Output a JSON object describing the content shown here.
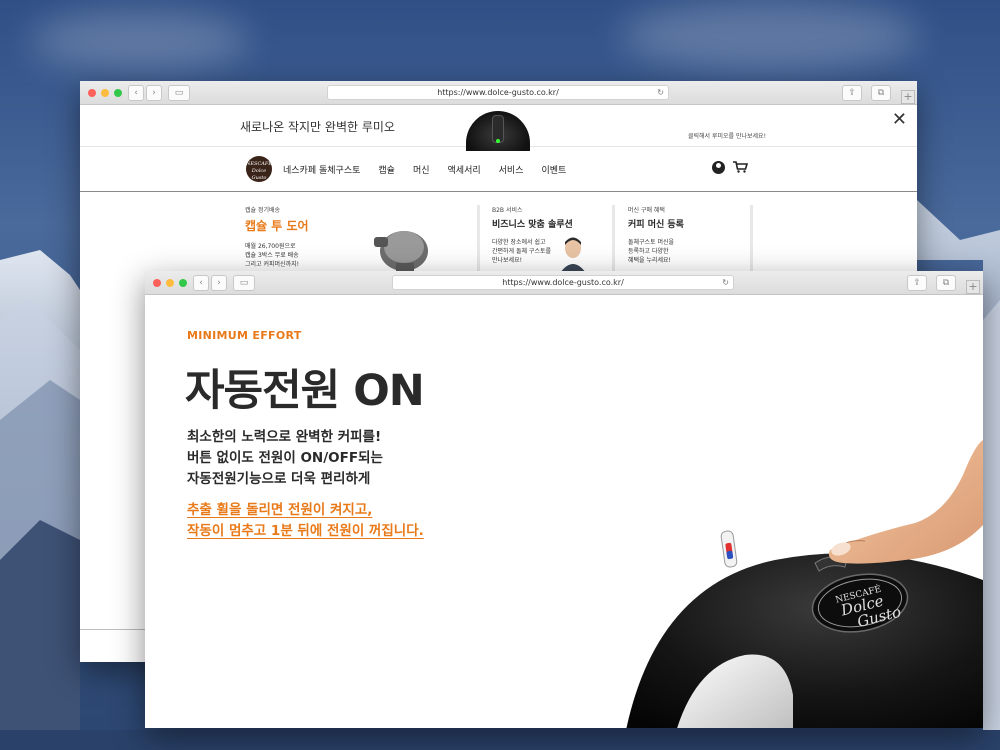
{
  "back_window": {
    "url": "https://www.dolce-gusto.co.kr/",
    "promo": {
      "text": "새로나온 작지만 완벽한 루미오",
      "right_text": "클릭해서 루미오를 만나보세요!"
    },
    "nav": {
      "logo_text": "NESCAFÉ Dolce Gusto",
      "items": [
        "네스카페 돌체구스토",
        "캡슐",
        "머신",
        "액세서리",
        "서비스",
        "이벤트"
      ]
    },
    "cards": [
      {
        "kicker": "캡슐 정기배송",
        "title": "캡슐 투 도어",
        "desc": [
          "매월 26,700원으로",
          "캡슐 3박스 무료 배송",
          "그리고 커피머신까지!"
        ]
      },
      {
        "kicker": "B2B 서비스",
        "title": "비즈니스 맞춤 솔루션",
        "desc": [
          "다양한 장소에서 쉽고",
          "간편하게 돌체 구스토를",
          "만나보세요!"
        ]
      },
      {
        "kicker": "머신 구매 혜택",
        "title": "커피 머신 등록",
        "desc": [
          "돌체구스토 머신을",
          "등록하고 다양한",
          "혜택을 누리세요!"
        ]
      }
    ]
  },
  "front_window": {
    "url": "https://www.dolce-gusto.co.kr/",
    "kicker": "MINIMUM EFFORT",
    "title": "자동전원 ON",
    "body": [
      "최소한의 노력으로 완벽한 커피를!",
      "버튼 없이도 전원이 ON/OFF되는",
      "자동전원기능으로 더욱 편리하게"
    ],
    "link": [
      "추출 휠을 돌리면 전원이 켜지고,",
      "작동이 멈추고 1분 뒤에 전원이 꺼집니다."
    ],
    "machine_logo": "NESCAFÉ Dolce Gusto"
  },
  "colors": {
    "accent_orange": "#e97a1a",
    "text_dark": "#2a2a2a"
  }
}
